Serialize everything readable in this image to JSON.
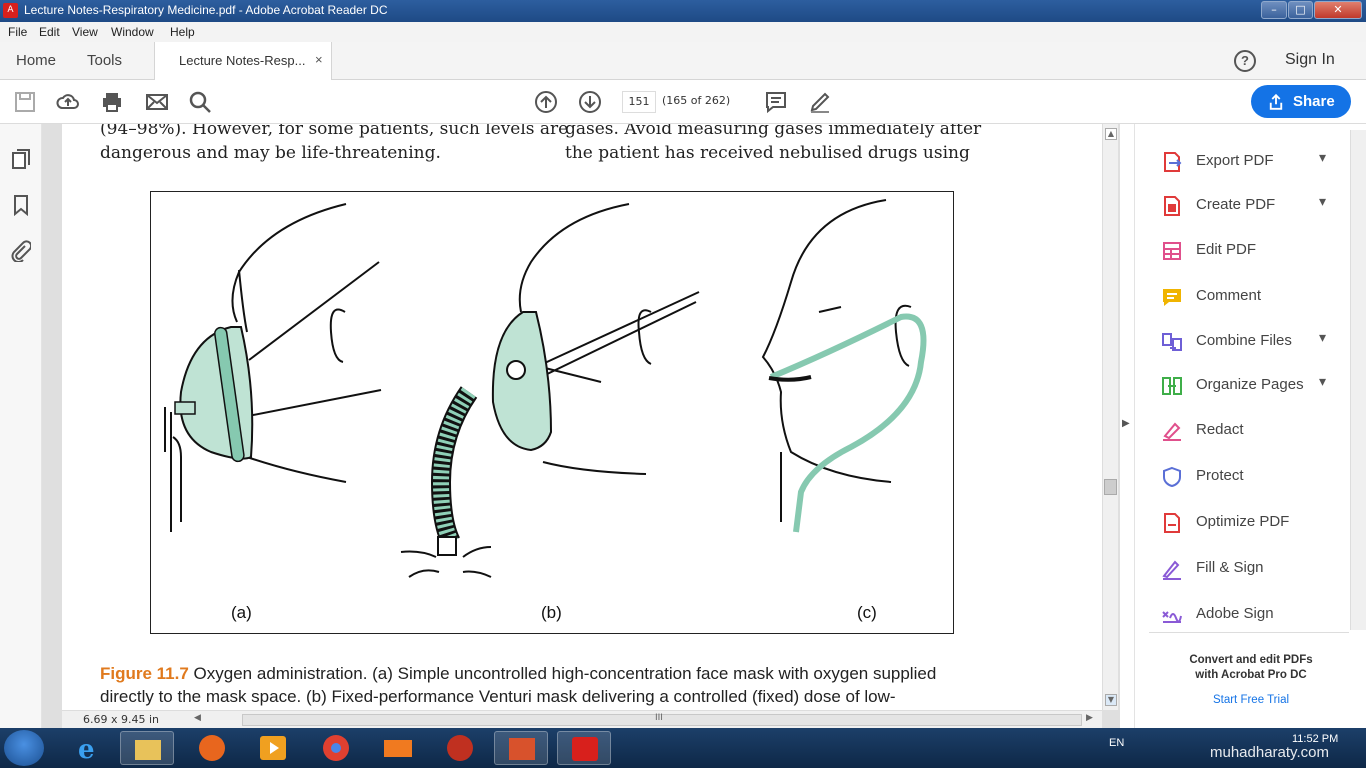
{
  "window": {
    "title": "Lecture Notes-Respiratory Medicine.pdf - Adobe Acrobat Reader DC",
    "minimize": "–",
    "maximize": "□",
    "close": "✕"
  },
  "menu": [
    "File",
    "Edit",
    "View",
    "Window",
    "Help"
  ],
  "tabs": {
    "home": "Home",
    "tools": "Tools",
    "document": "Lecture Notes-Resp...",
    "close": "×"
  },
  "header": {
    "help": "?",
    "sign_in": "Sign In"
  },
  "toolbar": {
    "icons": [
      "save-icon",
      "upload-icon",
      "print-icon",
      "email-icon",
      "search-icon",
      "page-up-icon",
      "page-down-icon",
      "comment-icon",
      "highlight-icon"
    ],
    "page_number": "151",
    "page_count": "(165 of 262)",
    "share_label": "Share"
  },
  "left_rail": {
    "icons": [
      "pages-icon",
      "bookmark-icon",
      "attachment-icon"
    ]
  },
  "document": {
    "left_col": [
      "(94–98%). However, for some patients, such levels are",
      "dangerous and may be life-threatening."
    ],
    "right_col": [
      "gases.  Avoid  measuring  gases  immediately  after",
      "the  patient  has  received  nebulised  drugs  using"
    ],
    "panel_labels": [
      "(a)",
      "(b)",
      "(c)"
    ],
    "caption_number": "Figure 11.7",
    "caption_line1": " Oxygen administration. (a) Simple uncontrolled high-concentration face mask with oxygen supplied",
    "caption_line2": "directly to the mask space. (b) Fixed-performance Venturi mask delivering a controlled (fixed) dose of low-",
    "page_size": "6.69 x 9.45 in",
    "hscroll_grip": "III"
  },
  "tools_panel": {
    "items": [
      {
        "label": "Export PDF",
        "icon": "export-pdf-icon",
        "color": "#e03a3a"
      },
      {
        "label": "Create PDF",
        "icon": "create-pdf-icon",
        "color": "#e03a3a"
      },
      {
        "label": "Edit PDF",
        "icon": "edit-pdf-icon",
        "color": "#e0508c"
      },
      {
        "label": "Comment",
        "icon": "comment-icon",
        "color": "#f0b400"
      },
      {
        "label": "Combine Files",
        "icon": "combine-files-icon",
        "color": "#6e5fd6"
      },
      {
        "label": "Organize Pages",
        "icon": "organize-pages-icon",
        "color": "#3fae49"
      },
      {
        "label": "Redact",
        "icon": "redact-icon",
        "color": "#e0508c"
      },
      {
        "label": "Protect",
        "icon": "protect-icon",
        "color": "#5a6fd6"
      },
      {
        "label": "Optimize PDF",
        "icon": "optimize-pdf-icon",
        "color": "#e03a3a"
      },
      {
        "label": "Fill & Sign",
        "icon": "fill-sign-icon",
        "color": "#8a5ad6"
      },
      {
        "label": "Adobe Sign",
        "icon": "adobe-sign-icon",
        "color": "#8a5ad6"
      }
    ],
    "chevron": "⌄",
    "promo_line1": "Convert and edit PDFs",
    "promo_line2": "with Acrobat Pro DC",
    "promo_link": "Start Free Trial"
  },
  "taskbar": {
    "apps": [
      "ie-icon",
      "explorer-icon",
      "firefox-icon",
      "media-player-icon",
      "chrome-icon",
      "mail-icon",
      "app-icon",
      "powerpoint-icon",
      "acrobat-icon"
    ],
    "lang": "EN",
    "time": "11:52 PM",
    "watermark": "muhadharaty.com"
  }
}
